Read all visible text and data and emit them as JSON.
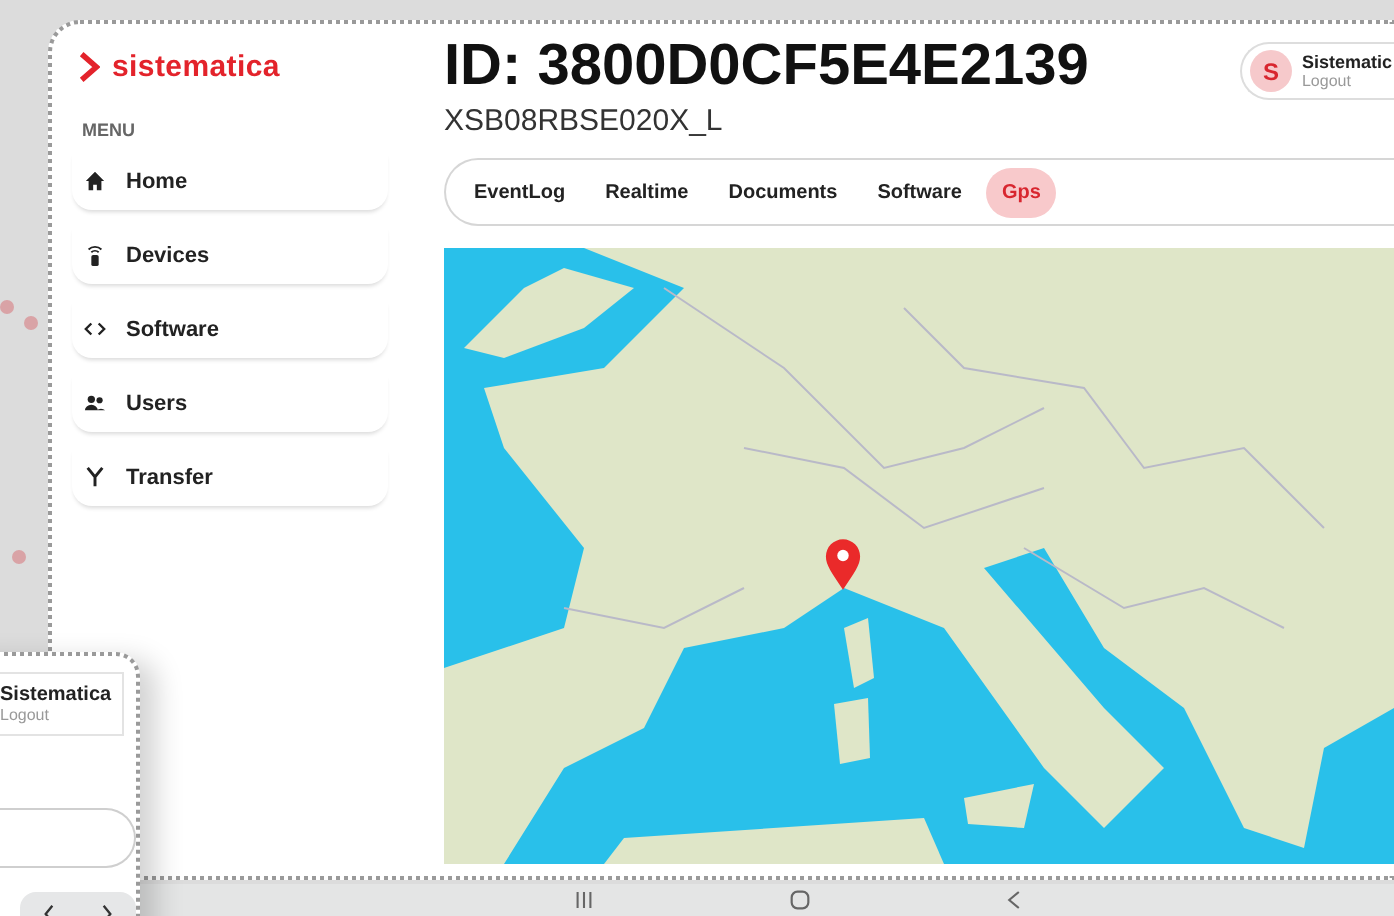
{
  "brand": {
    "name": "sistematica"
  },
  "sidebar": {
    "heading": "MENU",
    "items": [
      {
        "label": "Home",
        "kind": "home"
      },
      {
        "label": "Devices",
        "kind": "remote"
      },
      {
        "label": "Software",
        "kind": "code"
      },
      {
        "label": "Users",
        "kind": "users"
      },
      {
        "label": "Transfer",
        "kind": "fork"
      }
    ]
  },
  "device": {
    "title": "ID: 3800D0CF5E4E2139",
    "model": "XSB08RBSE020X_L"
  },
  "user": {
    "initial": "S",
    "name": "Sistematic",
    "action": "Logout"
  },
  "tabs": [
    {
      "label": "EventLog",
      "selected": false
    },
    {
      "label": "Realtime",
      "selected": false
    },
    {
      "label": "Documents",
      "selected": false
    },
    {
      "label": "Software",
      "selected": false
    },
    {
      "label": "Gps",
      "selected": true
    }
  ],
  "phone": {
    "user": {
      "name": "Sistematica",
      "action": "Logout"
    }
  }
}
